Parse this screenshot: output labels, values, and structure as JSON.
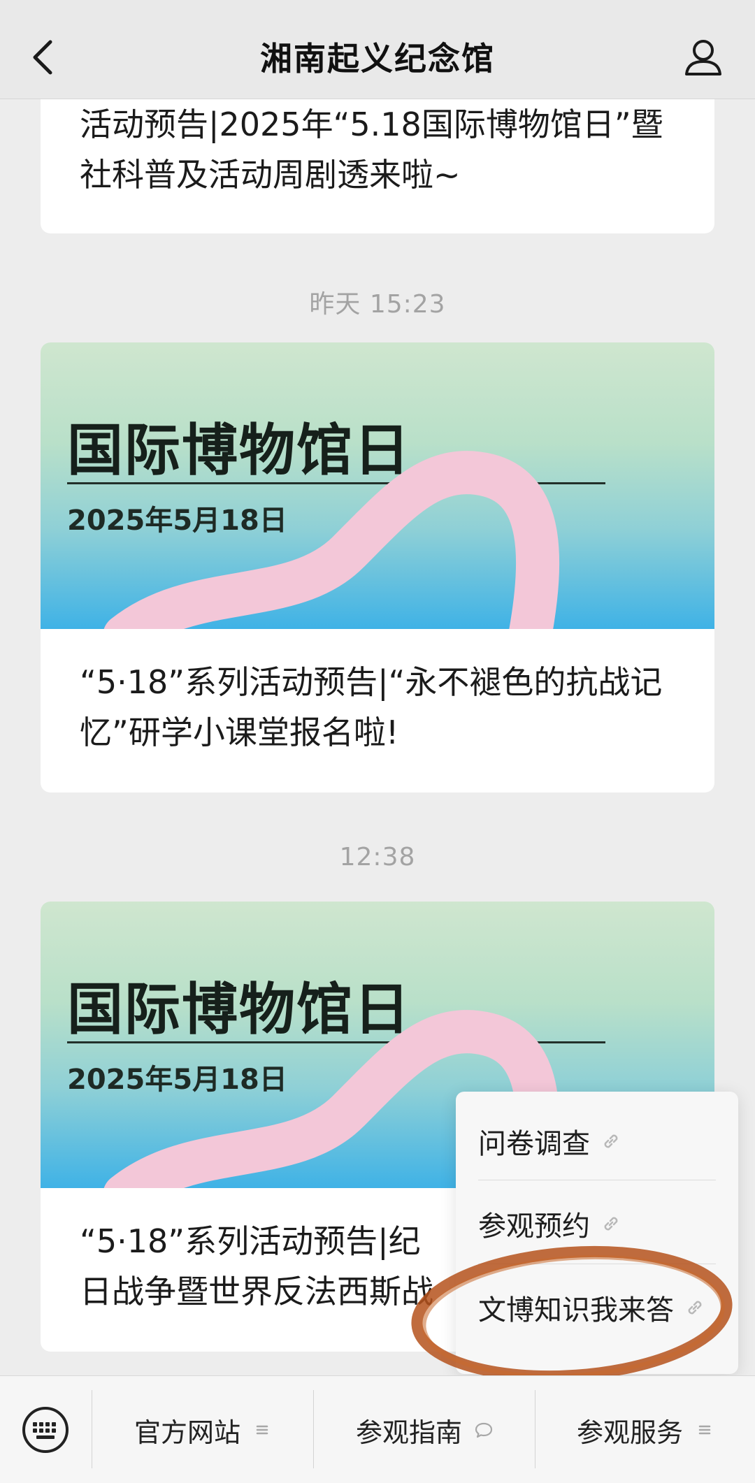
{
  "header": {
    "title": "湘南起义纪念馆"
  },
  "feed": {
    "first_card_title": "活动预告|2025年“5.18国际博物馆日”暨社科普及活动周剧透来啦~",
    "items": [
      {
        "timestamp": "昨天 15:23",
        "cover_title": "国际博物馆日",
        "cover_date": "2025年5月18日",
        "title": "“5·18”系列活动预告|“永不褪色的抗战记忆”研学小课堂报名啦!"
      },
      {
        "timestamp": "12:38",
        "cover_title": "国际博物馆日",
        "cover_date": "2025年5月18日",
        "title_line1": "“5·18”系列活动预告|纪",
        "title_line2": "日战争暨世界反法西斯战"
      }
    ]
  },
  "popup_menu": {
    "items": [
      {
        "label": "问卷调查",
        "icon": "link-icon"
      },
      {
        "label": "参观预约",
        "icon": "link-icon"
      },
      {
        "label": "文博知识我来答",
        "icon": "link-icon"
      }
    ],
    "highlight_color": "#b5521c"
  },
  "bottom_bar": {
    "menus": [
      {
        "label": "官方网站",
        "icon": "list-icon"
      },
      {
        "label": "参观指南",
        "icon": "chat-bubble-icon"
      },
      {
        "label": "参观服务",
        "icon": "list-icon"
      }
    ]
  }
}
